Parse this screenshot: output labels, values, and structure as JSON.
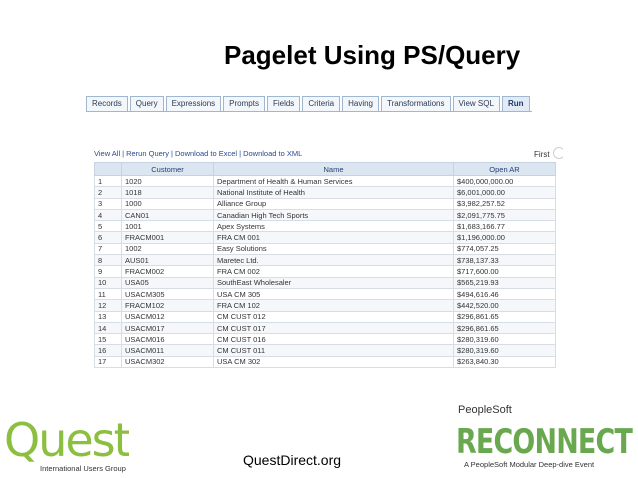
{
  "slide": {
    "title": "Pagelet Using PS/Query"
  },
  "tabs": [
    {
      "label": "Records",
      "active": false
    },
    {
      "label": "Query",
      "active": false
    },
    {
      "label": "Expressions",
      "active": false
    },
    {
      "label": "Prompts",
      "active": false
    },
    {
      "label": "Fields",
      "active": false
    },
    {
      "label": "Criteria",
      "active": false
    },
    {
      "label": "Having",
      "active": false
    },
    {
      "label": "Transformations",
      "active": false
    },
    {
      "label": "View SQL",
      "active": false
    },
    {
      "label": "Run",
      "active": true
    }
  ],
  "results": {
    "links": {
      "view_all": "View All",
      "rerun": "Rerun Query",
      "excel": "Download to Excel",
      "xml": "Download to XML",
      "separator": "|"
    },
    "first_label": "First",
    "columns": [
      "",
      "Customer",
      "Name",
      "Open AR"
    ],
    "rows": [
      [
        "1",
        "1020",
        "Department of Health & Human Services",
        "$400,000,000.00"
      ],
      [
        "2",
        "1018",
        "National Institute of Health",
        "$6,001,000.00"
      ],
      [
        "3",
        "1000",
        "Alliance Group",
        "$3,982,257.52"
      ],
      [
        "4",
        "CAN01",
        "Canadian High Tech Sports",
        "$2,091,775.75"
      ],
      [
        "5",
        "1001",
        "Apex Systems",
        "$1,683,166.77"
      ],
      [
        "6",
        "FRACM001",
        "FRA CM 001",
        "$1,196,000.00"
      ],
      [
        "7",
        "1002",
        "Easy Solutions",
        "$774,057.25"
      ],
      [
        "8",
        "AUS01",
        "Maretec Ltd.",
        "$738,137.33"
      ],
      [
        "9",
        "FRACM002",
        "FRA CM 002",
        "$717,600.00"
      ],
      [
        "10",
        "USA05",
        "SouthEast Wholesaler",
        "$565,219.93"
      ],
      [
        "11",
        "USACM305",
        "USA CM 305",
        "$494,616.46"
      ],
      [
        "12",
        "FRACM102",
        "FRA CM 102",
        "$442,520.00"
      ],
      [
        "13",
        "USACM012",
        "CM CUST 012",
        "$296,861.65"
      ],
      [
        "14",
        "USACM017",
        "CM CUST 017",
        "$296,861.65"
      ],
      [
        "15",
        "USACM016",
        "CM CUST 016",
        "$280,319.60"
      ],
      [
        "16",
        "USACM011",
        "CM CUST 011",
        "$280,319.60"
      ],
      [
        "17",
        "USACM302",
        "USA CM 302",
        "$263,840.30"
      ]
    ]
  },
  "footer": {
    "quest_logo_text": "Quest",
    "quest_subtitle": "International Users Group",
    "questdirect": "QuestDirect.org",
    "peoplesoft": "PeopleSoft",
    "reconnect_logo_text": "RECONNECT",
    "reconnect_subtitle": "A PeopleSoft Modular Deep-dive Event"
  },
  "colors": {
    "quest_green": "#8cbf3f",
    "reconnect_green": "#6aa84f",
    "link_blue": "#2b4b8f",
    "header_blue": "#dce6f1"
  }
}
